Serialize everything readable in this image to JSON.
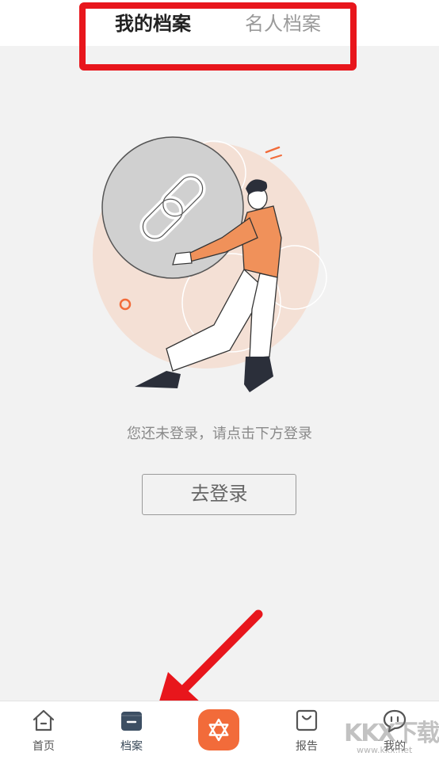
{
  "header": {
    "tabs": [
      {
        "label": "我的档案",
        "active": true
      },
      {
        "label": "名人档案",
        "active": false
      }
    ]
  },
  "empty_state": {
    "illustration": "person-carrying-link-icon",
    "message": "您还未登录，请点击下方登录",
    "login_button": "去登录"
  },
  "bottom_nav": {
    "items": [
      {
        "label": "首页",
        "icon": "home-icon"
      },
      {
        "label": "档案",
        "icon": "folder-icon",
        "active": true
      },
      {
        "label": "",
        "icon": "star-of-david-icon",
        "center": true
      },
      {
        "label": "报告",
        "icon": "bag-icon"
      },
      {
        "label": "我的",
        "icon": "chat-bubble-icon"
      }
    ]
  },
  "watermark": {
    "logo": "KKX下载",
    "url": "www.kkx.net"
  },
  "colors": {
    "accent": "#f26b3a",
    "annotation_red": "#e8161c",
    "background": "#f2f2f2"
  }
}
